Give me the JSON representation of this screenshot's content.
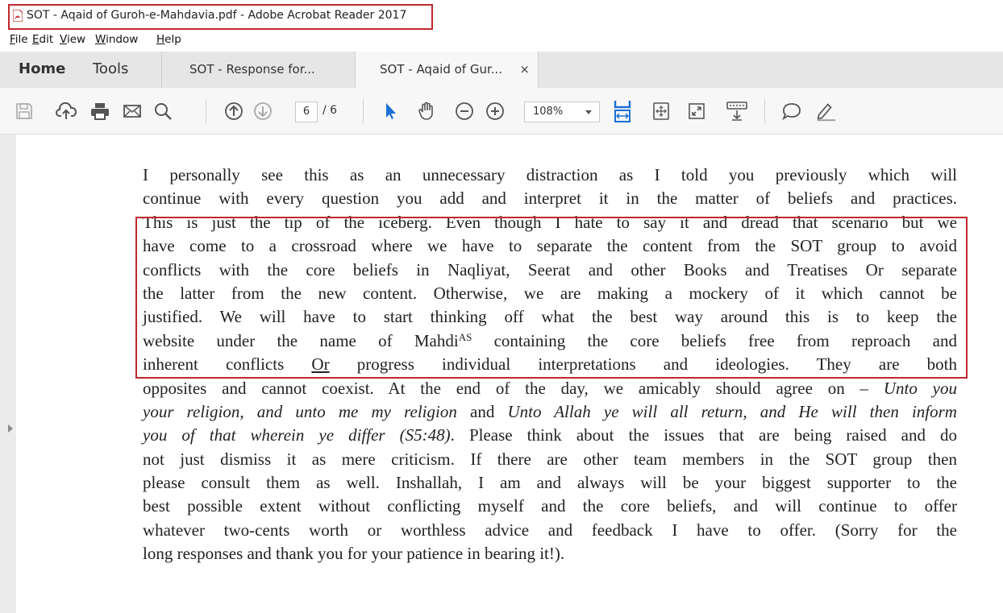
{
  "window": {
    "title": "SOT - Aqaid of Guroh-e-Mahdavia.pdf - Adobe Acrobat Reader 2017"
  },
  "menu": {
    "items": [
      {
        "accel": "F",
        "rest": "ile"
      },
      {
        "accel": "E",
        "rest": "dit"
      },
      {
        "accel": "V",
        "rest": "iew"
      },
      {
        "accel": "W",
        "rest": "indow"
      },
      {
        "accel": "H",
        "rest": "elp"
      }
    ]
  },
  "tabs": {
    "home": "Home",
    "tools": "Tools",
    "documents": [
      {
        "label": "SOT - Response for..."
      },
      {
        "label": "SOT - Aqaid of Gur...",
        "close": "×"
      }
    ]
  },
  "toolbar": {
    "page_current": "6",
    "page_total": "/ 6",
    "zoom": "108%",
    "icons": [
      "save-icon",
      "upload-cloud-icon",
      "print-icon",
      "email-icon",
      "search-icon",
      "page-up-icon",
      "page-down-icon",
      "select-cursor-icon",
      "hand-tool-icon",
      "zoom-out-icon",
      "zoom-in-icon",
      "fit-width-icon",
      "fit-page-icon",
      "full-screen-icon",
      "read-mode-icon",
      "comment-icon",
      "sign-icon"
    ],
    "accent": "#1a6fd6"
  },
  "annotation_color": "#c0282d",
  "document": {
    "lines": [
      [
        {
          "t": "I personally see this as an unnecessary distraction as I told you previously which will"
        }
      ],
      [
        {
          "t": "continue with every question you add and interpret it in the matter of beliefs and practices."
        }
      ],
      [
        {
          "t": "This is just the tip of the iceberg. Even though I hate to say it and dread that scenario but we"
        }
      ],
      [
        {
          "t": "have come to a crossroad where we have to separate the content from the SOT group to avoid"
        }
      ],
      [
        {
          "t": "conflicts with the core beliefs in Naqliyat, Seerat and other Books and Treatises Or separate"
        }
      ],
      [
        {
          "t": "the latter from the new content. Otherwise, we are making a mockery of it which cannot be"
        }
      ],
      [
        {
          "t": "justified. We will have to start thinking off what the best way around this is to keep the"
        }
      ],
      [
        {
          "t": "website under the name of Mahdi"
        },
        {
          "t": "AS",
          "sup": true
        },
        {
          "t": " containing the core beliefs free from reproach and"
        }
      ],
      [
        {
          "t": "inherent conflicts "
        },
        {
          "t": "Or",
          "u": true
        },
        {
          "t": " progress individual interpretations and ideologies. They are both"
        }
      ],
      [
        {
          "t": "opposites and cannot coexist. At the end of the day, we amicably should agree on – "
        },
        {
          "t": "Unto you",
          "i": true
        }
      ],
      [
        {
          "t": "your religion, and unto me my religion",
          "i": true
        },
        {
          "t": " and "
        },
        {
          "t": "Unto Allah ye will all return, and He will then inform",
          "i": true
        }
      ],
      [
        {
          "t": "you of that wherein ye differ (S5:48)",
          "i": true
        },
        {
          "t": ". Please think about the issues that are being raised and do"
        }
      ],
      [
        {
          "t": "not just dismiss it as mere criticism. If there are other team members in the SOT group then"
        }
      ],
      [
        {
          "t": "please consult them as well. Inshallah, I am and always will be your biggest supporter to the"
        }
      ],
      [
        {
          "t": "best possible extent without conflicting myself and the core beliefs, and will continue to offer"
        }
      ],
      [
        {
          "t": "whatever two-cents worth or worthless advice and feedback I have to offer. (Sorry for the"
        }
      ],
      [
        {
          "t": "long responses and thank you for your patience in bearing it!)."
        }
      ]
    ]
  }
}
